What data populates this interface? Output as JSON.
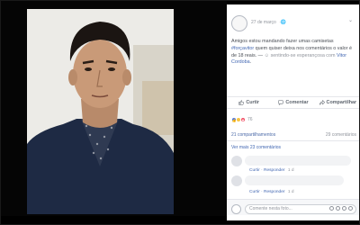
{
  "post": {
    "date": "27 de março",
    "text_before": "Amigos estou mandando fazer umas camisetas ",
    "hashtag": "#forçavitor",
    "text_after": " quem quiser deixa nos comentários o valor é de 18 reais. — ",
    "feeling": "sentindo-se esperançosa com",
    "mention": "Vitor Cordoba",
    "mention_end": "."
  },
  "actions": {
    "like": "Curtir",
    "comment": "Comentar",
    "share": "Compartilhar"
  },
  "reactions": {
    "count": "76"
  },
  "stats": {
    "shares": "21 compartilhamentos",
    "comments": "29 comentários"
  },
  "comments": {
    "more": "Ver mais 23 comentários",
    "items": [
      {
        "like": "Curtir",
        "reply": "Responder",
        "time": "1 d"
      },
      {
        "like": "Curtir",
        "reply": "Responder",
        "time": "1 d"
      }
    ]
  },
  "composer": {
    "placeholder": "Comente nesta foto..."
  },
  "colors": {
    "link": "#4267b2",
    "like": "#4a76e8",
    "wow": "#f7c544",
    "love": "#f25268"
  },
  "icons": {
    "like": "thumbs-up-icon",
    "comment": "speech-bubble-icon",
    "share": "share-arrow-icon",
    "privacy": "globe-icon"
  }
}
